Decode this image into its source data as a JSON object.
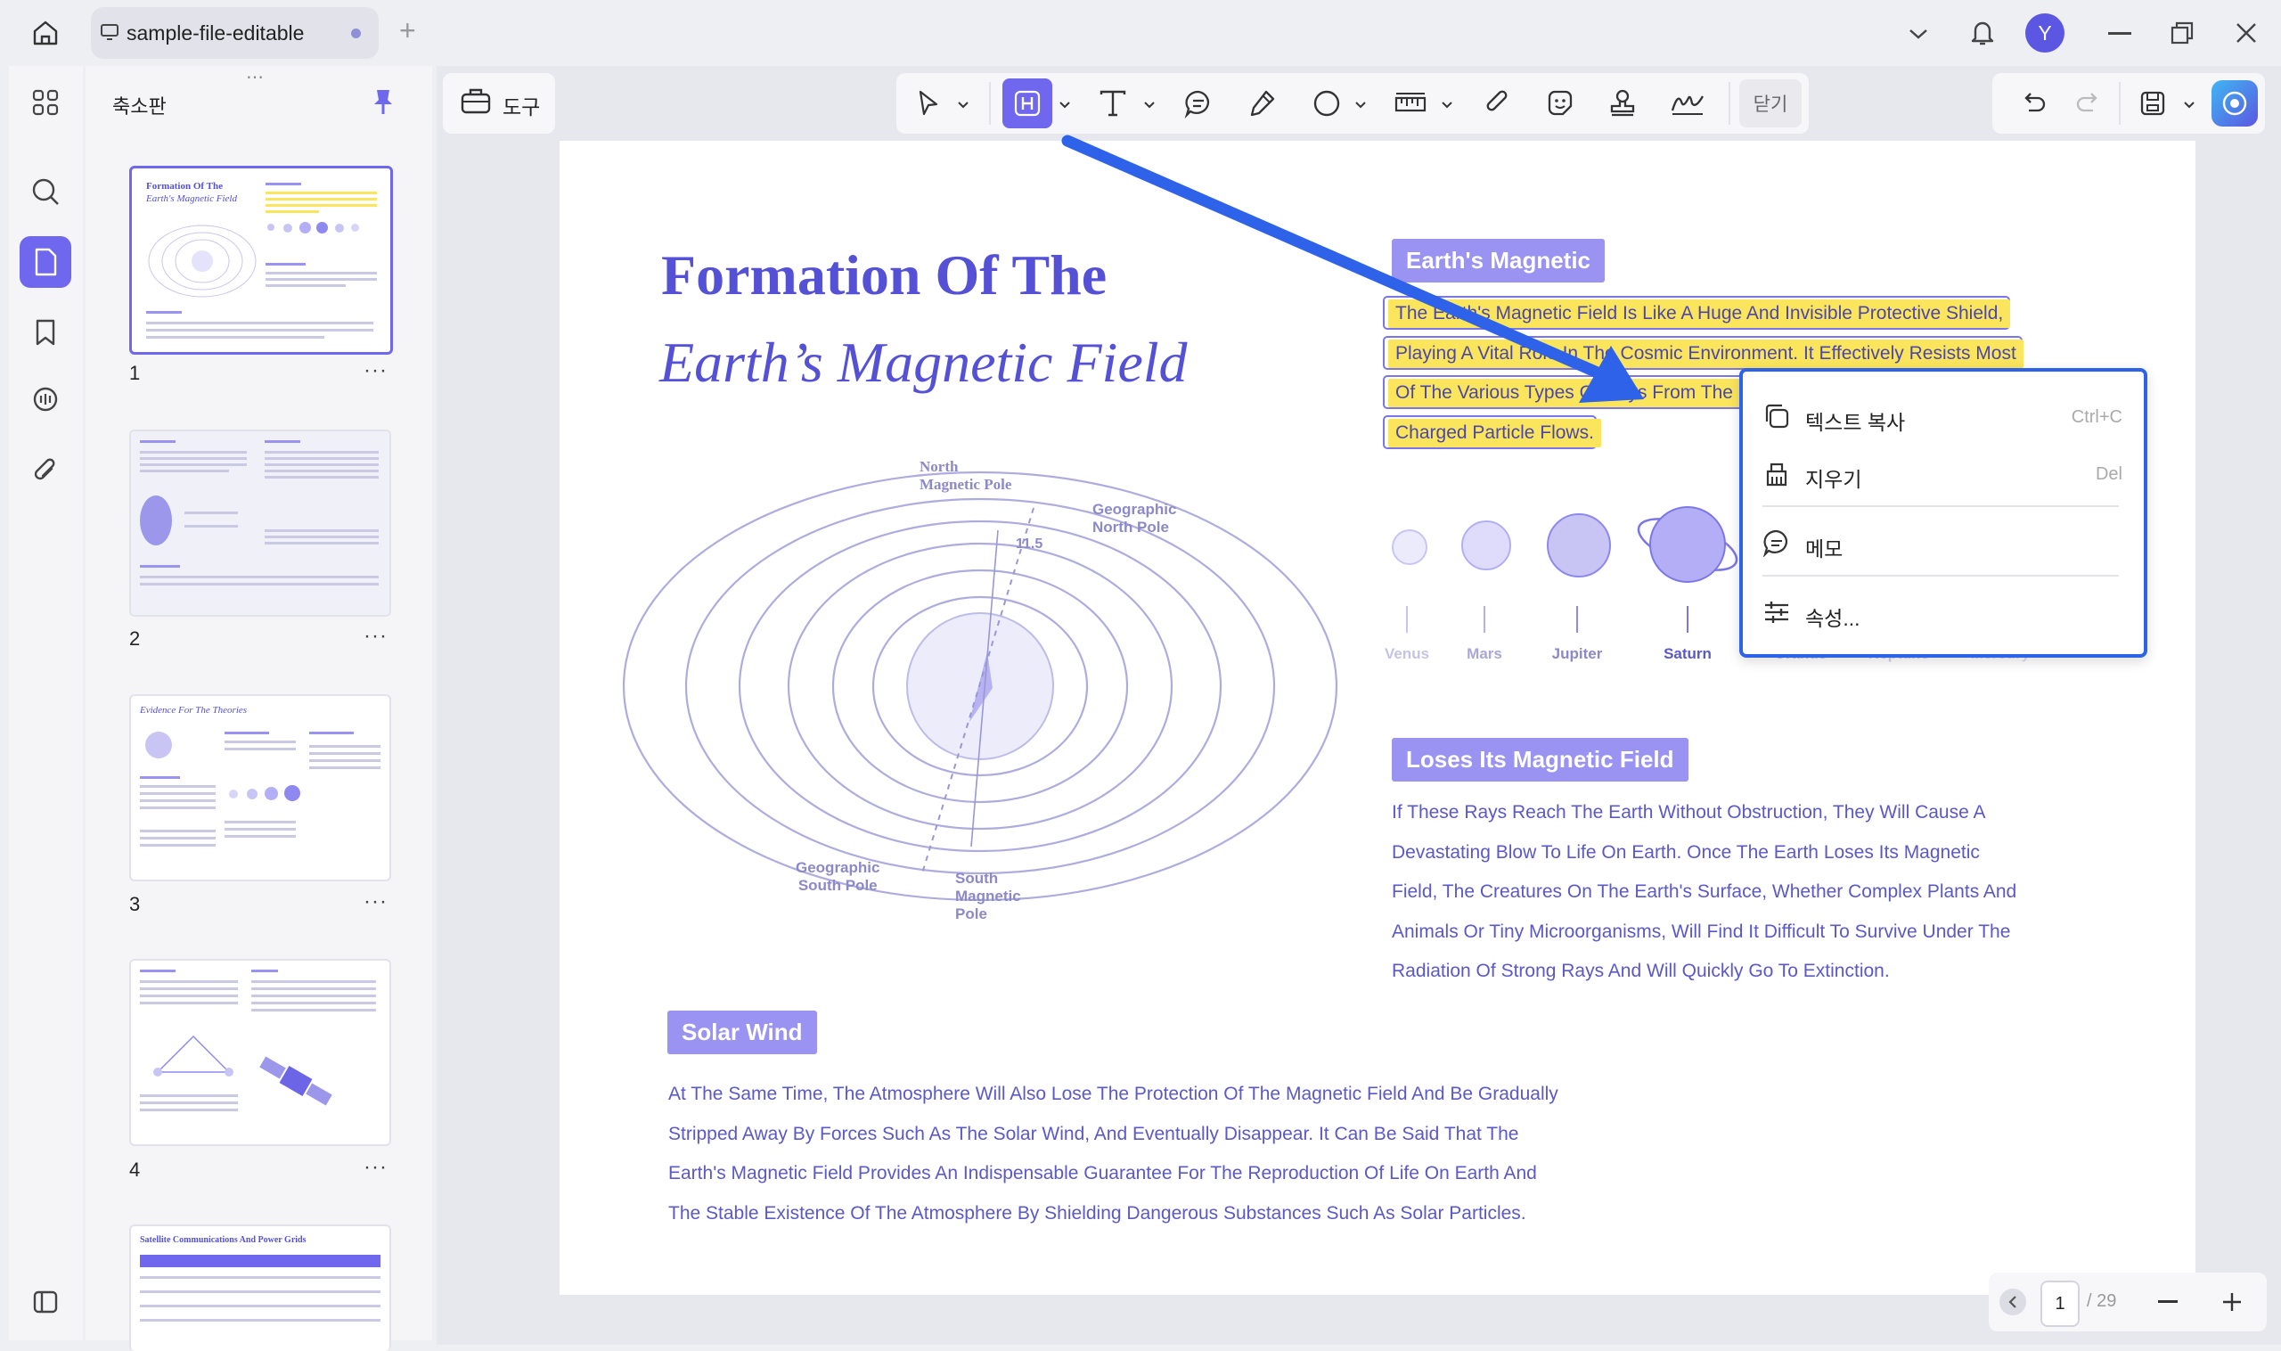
{
  "window": {
    "tab_title": "sample-file-editable",
    "add_tab": "+",
    "avatar_letter": "Y"
  },
  "thumbnails": {
    "panel_title": "축소판",
    "pages": [
      {
        "num": "1",
        "title_serif": "Formation Of The",
        "title_italic": "Earth's Magnetic Field"
      },
      {
        "num": "2"
      },
      {
        "num": "3",
        "title_serif": "Evidence For The Theories"
      },
      {
        "num": "4"
      },
      {
        "num": "",
        "title_serif": "Satellite Communications And Power Grids"
      }
    ],
    "more": "···"
  },
  "toolbar": {
    "tools_label": "도구",
    "close_label": "닫기"
  },
  "document": {
    "title_line1": "Formation Of The",
    "title_line2": "Earth’s Magnetic Field",
    "earth_magnetic_tag": "Earth's Magnetic",
    "highlight_lines": [
      "The Earth's Magnetic Field Is Like A Huge And Invisible Protective Shield,",
      "Playing A Vital Role In The Cosmic Environment. It Effectively Resists Most",
      "Of The Various Types Of Rays From The Universe",
      "Charged Particle Flows."
    ],
    "diagram_labels": {
      "north_magnetic_pole": [
        "North",
        "Magnetic Pole"
      ],
      "geographic_north_pole": [
        "Geographic",
        "North Pole"
      ],
      "angle": "11.5",
      "geographic_south_pole": [
        "Geographic",
        "South Pole"
      ],
      "south_magnetic_pole": [
        "South",
        "Magnetic",
        "Pole"
      ]
    },
    "planets": [
      "Venus",
      "Mars",
      "Jupiter",
      "Saturn",
      "Uranus",
      "Neptune",
      "Mercury"
    ],
    "loses_tag": "Loses Its Magnetic Field",
    "loses_lines": [
      "If These Rays Reach The Earth Without Obstruction, They Will Cause A",
      "Devastating Blow To Life On Earth. Once The Earth Loses Its Magnetic",
      "Field, The Creatures On The Earth's Surface, Whether Complex Plants And",
      "Animals Or Tiny Microorganisms, Will Find It Difficult To Survive Under The",
      "Radiation Of Strong Rays And Will Quickly Go To Extinction."
    ],
    "solar_tag": "Solar Wind",
    "solar_lines": [
      "At The Same Time, The Atmosphere Will Also Lose The Protection Of The Magnetic Field And Be Gradually",
      "Stripped Away By Forces Such As The Solar Wind, And Eventually Disappear. It Can Be Said That The",
      "Earth's Magnetic Field Provides An Indispensable Guarantee For The Reproduction Of Life On Earth And",
      "The Stable Existence Of The Atmosphere By Shielding Dangerous Substances Such As Solar Particles."
    ]
  },
  "context_menu": {
    "copy_text": "텍스트 복사",
    "copy_shortcut": "Ctrl+C",
    "delete": "지우기",
    "delete_shortcut": "Del",
    "memo": "메모",
    "properties": "속성..."
  },
  "pager": {
    "current": "1",
    "total": "/ 29"
  },
  "colors": {
    "accent": "#7067ef",
    "highlight": "#fbe55c",
    "menu_border": "#2e62e8",
    "doc_text": "#5b58c8"
  }
}
